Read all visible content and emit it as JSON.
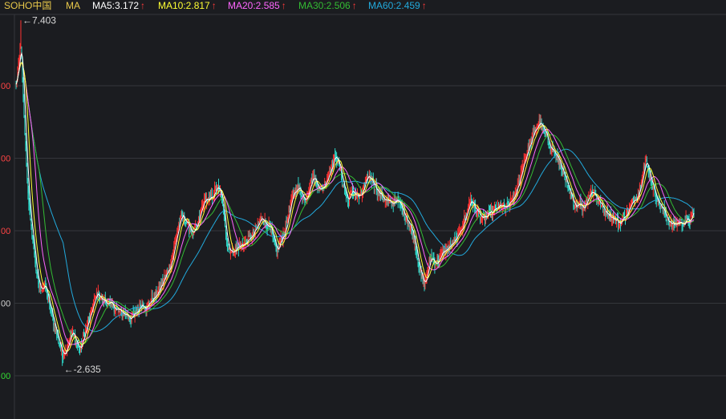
{
  "legend": {
    "symbol": "SOHO中国",
    "ma_label": "MA",
    "ma5": "MA5:3.172",
    "ma10": "MA10:2.817",
    "ma20": "MA20:2.585",
    "ma30": "MA30:2.506",
    "ma60": "MA60:2.459",
    "up_arrow": "↑"
  },
  "colors": {
    "background": "#1b1c20",
    "grid": "#34363b",
    "up": "#ff3232",
    "down": "#2ed6c8",
    "ma5": "#ffffff",
    "ma10": "#ffff33",
    "ma20": "#ff66ff",
    "ma30": "#33bb33",
    "ma60": "#22aadd"
  },
  "chart_data": {
    "type": "line",
    "title": "",
    "ylim": [
      2.4,
      7.6
    ],
    "y_tick_labels": [
      {
        "value": 6.5,
        "label": "00",
        "color": "#ff4444"
      },
      {
        "value": 5.5,
        "label": "00",
        "color": "#ff4444"
      },
      {
        "value": 4.5,
        "label": "00",
        "color": "#ff4444"
      },
      {
        "value": 3.5,
        "label": "00",
        "color": "#d0d0d0"
      },
      {
        "value": 2.5,
        "label": "00",
        "color": "#33dd33"
      }
    ],
    "annotations": [
      {
        "label": "←7.403",
        "value": 7.403
      },
      {
        "label": "←-2.635",
        "value": 2.635
      }
    ],
    "x_index_range": [
      0,
      850
    ],
    "price_path": [
      [
        0,
        6.5
      ],
      [
        3,
        6.8
      ],
      [
        6,
        7.1
      ],
      [
        9,
        6.3
      ],
      [
        14,
        5.2
      ],
      [
        18,
        4.6
      ],
      [
        22,
        4.3
      ],
      [
        26,
        3.85
      ],
      [
        30,
        3.7
      ],
      [
        36,
        3.75
      ],
      [
        42,
        3.45
      ],
      [
        48,
        3.2
      ],
      [
        54,
        2.95
      ],
      [
        58,
        2.8
      ],
      [
        62,
        2.85
      ],
      [
        66,
        3.0
      ],
      [
        70,
        3.1
      ],
      [
        76,
        2.95
      ],
      [
        80,
        2.85
      ],
      [
        86,
        3.1
      ],
      [
        92,
        3.3
      ],
      [
        97,
        3.5
      ],
      [
        102,
        3.65
      ],
      [
        107,
        3.55
      ],
      [
        115,
        3.5
      ],
      [
        122,
        3.45
      ],
      [
        130,
        3.38
      ],
      [
        137,
        3.35
      ],
      [
        144,
        3.3
      ],
      [
        150,
        3.35
      ],
      [
        157,
        3.5
      ],
      [
        163,
        3.45
      ],
      [
        170,
        3.55
      ],
      [
        175,
        3.6
      ],
      [
        180,
        3.7
      ],
      [
        186,
        3.85
      ],
      [
        192,
        4.0
      ],
      [
        197,
        4.2
      ],
      [
        202,
        4.5
      ],
      [
        207,
        4.7
      ],
      [
        212,
        4.65
      ],
      [
        217,
        4.55
      ],
      [
        222,
        4.45
      ],
      [
        227,
        4.55
      ],
      [
        232,
        4.8
      ],
      [
        237,
        4.95
      ],
      [
        242,
        4.9
      ],
      [
        247,
        5.0
      ],
      [
        252,
        5.1
      ],
      [
        257,
        5.0
      ],
      [
        262,
        4.6
      ],
      [
        265,
        4.3
      ],
      [
        270,
        4.2
      ],
      [
        275,
        4.25
      ],
      [
        282,
        4.3
      ],
      [
        290,
        4.35
      ],
      [
        297,
        4.45
      ],
      [
        302,
        4.55
      ],
      [
        308,
        4.7
      ],
      [
        313,
        4.6
      ],
      [
        318,
        4.55
      ],
      [
        323,
        4.35
      ],
      [
        327,
        4.2
      ],
      [
        331,
        4.35
      ],
      [
        337,
        4.5
      ],
      [
        342,
        4.75
      ],
      [
        347,
        5.0
      ],
      [
        352,
        5.1
      ],
      [
        357,
        5.05
      ],
      [
        362,
        4.9
      ],
      [
        367,
        5.1
      ],
      [
        372,
        5.25
      ],
      [
        377,
        5.15
      ],
      [
        382,
        5.05
      ],
      [
        387,
        5.15
      ],
      [
        392,
        5.3
      ],
      [
        397,
        5.45
      ],
      [
        401,
        5.55
      ],
      [
        406,
        5.35
      ],
      [
        411,
        5.1
      ],
      [
        416,
        4.9
      ],
      [
        421,
        5.05
      ],
      [
        426,
        5.0
      ],
      [
        431,
        4.95
      ],
      [
        436,
        5.1
      ],
      [
        441,
        5.25
      ],
      [
        446,
        5.2
      ],
      [
        451,
        5.1
      ],
      [
        456,
        5.0
      ],
      [
        461,
        4.95
      ],
      [
        466,
        4.9
      ],
      [
        471,
        4.85
      ],
      [
        476,
        4.95
      ],
      [
        481,
        4.85
      ],
      [
        486,
        4.75
      ],
      [
        491,
        4.65
      ],
      [
        496,
        4.5
      ],
      [
        500,
        4.35
      ],
      [
        504,
        4.1
      ],
      [
        508,
        3.85
      ],
      [
        512,
        3.75
      ],
      [
        516,
        3.95
      ],
      [
        520,
        4.15
      ],
      [
        525,
        4.05
      ],
      [
        530,
        4.1
      ],
      [
        535,
        4.2
      ],
      [
        540,
        4.25
      ],
      [
        545,
        4.3
      ],
      [
        550,
        4.35
      ],
      [
        555,
        4.45
      ],
      [
        560,
        4.6
      ],
      [
        565,
        4.75
      ],
      [
        570,
        4.95
      ],
      [
        575,
        4.8
      ],
      [
        580,
        4.75
      ],
      [
        585,
        4.65
      ],
      [
        590,
        4.7
      ],
      [
        596,
        4.75
      ],
      [
        602,
        4.8
      ],
      [
        608,
        4.85
      ],
      [
        614,
        4.8
      ],
      [
        620,
        4.9
      ],
      [
        626,
        5.0
      ],
      [
        631,
        5.2
      ],
      [
        636,
        5.45
      ],
      [
        641,
        5.6
      ],
      [
        646,
        5.75
      ],
      [
        651,
        5.9
      ],
      [
        656,
        6.0
      ],
      [
        661,
        5.9
      ],
      [
        666,
        5.75
      ],
      [
        671,
        5.65
      ],
      [
        676,
        5.55
      ],
      [
        681,
        5.45
      ],
      [
        686,
        5.3
      ],
      [
        691,
        5.1
      ],
      [
        696,
        4.95
      ],
      [
        701,
        4.85
      ],
      [
        706,
        4.9
      ],
      [
        711,
        4.8
      ],
      [
        716,
        4.95
      ],
      [
        721,
        5.05
      ],
      [
        726,
        5.0
      ],
      [
        731,
        4.9
      ],
      [
        736,
        4.8
      ],
      [
        741,
        4.75
      ],
      [
        746,
        4.7
      ],
      [
        751,
        4.65
      ],
      [
        756,
        4.6
      ],
      [
        761,
        4.68
      ],
      [
        766,
        4.75
      ],
      [
        771,
        4.85
      ],
      [
        776,
        4.95
      ],
      [
        781,
        5.05
      ],
      [
        786,
        5.35
      ],
      [
        790,
        5.45
      ],
      [
        795,
        5.25
      ],
      [
        800,
        5.05
      ],
      [
        805,
        4.9
      ],
      [
        810,
        4.8
      ],
      [
        815,
        4.7
      ],
      [
        820,
        4.6
      ],
      [
        825,
        4.58
      ],
      [
        830,
        4.62
      ],
      [
        835,
        4.6
      ],
      [
        840,
        4.65
      ],
      [
        845,
        4.63
      ],
      [
        850,
        4.78
      ]
    ],
    "extremes": [
      {
        "index": 6,
        "value": 7.403
      },
      {
        "index": 58,
        "value": 2.635
      }
    ]
  }
}
